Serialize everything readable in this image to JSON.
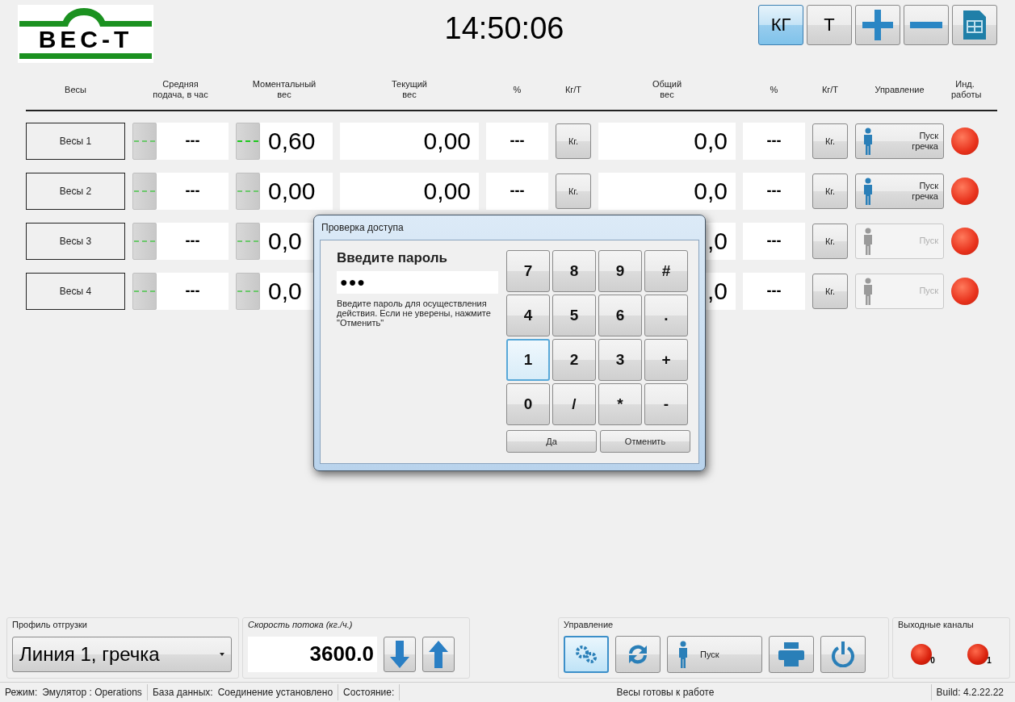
{
  "header": {
    "logo": "ВЕС-Т",
    "clock": "14:50:06",
    "unit_buttons": [
      {
        "label": "КГ",
        "selected": true
      },
      {
        "label": "Т",
        "selected": false
      }
    ],
    "tool_buttons": [
      {
        "kind": "plus"
      },
      {
        "kind": "minus"
      },
      {
        "kind": "table"
      }
    ]
  },
  "columns": [
    "Весы",
    "Средняя\nподача, в час",
    "Моментальный\nвес",
    "Текущий\nвес",
    "%",
    "Кг/Т",
    "Общий\nвес",
    "%",
    "Кг/Т",
    "Управление",
    "Инд.\nработы"
  ],
  "scales": [
    {
      "name": "Весы 1",
      "avg": "---",
      "avg_active": false,
      "moment": "0,60",
      "moment_active": true,
      "current": "0,00",
      "pct": "---",
      "unit": "Кг.",
      "total": "0,0",
      "pct2": "---",
      "unit2": "Кг.",
      "control": {
        "label": "Пуск\nгречка",
        "enabled": true
      }
    },
    {
      "name": "Весы 2",
      "avg": "---",
      "avg_active": false,
      "moment": "0,00",
      "moment_active": false,
      "current": "0,00",
      "pct": "---",
      "unit": "Кг.",
      "total": "0,0",
      "pct2": "---",
      "unit2": "Кг.",
      "control": {
        "label": "Пуск\nгречка",
        "enabled": true
      }
    },
    {
      "name": "Весы 3",
      "avg": "---",
      "avg_active": false,
      "moment": "0,0",
      "moment_active": false,
      "total": ",0",
      "pct2": "---",
      "unit2": "Кг.",
      "control": {
        "label": "Пуск",
        "enabled": false
      }
    },
    {
      "name": "Весы 4",
      "avg": "---",
      "avg_active": false,
      "moment": "0,0",
      "moment_active": false,
      "total": ",0",
      "pct2": "---",
      "unit2": "Кг.",
      "control": {
        "label": "Пуск",
        "enabled": false
      }
    }
  ],
  "dialog": {
    "title": "Проверка доступа",
    "heading": "Введите пароль",
    "password": "●●●",
    "hint": "Введите пароль для осуществления действия. Если не уверены, нажмите \"Отменить\"",
    "keys": [
      {
        "label": "7",
        "focused": false
      },
      {
        "label": "8",
        "focused": false
      },
      {
        "label": "9",
        "focused": false
      },
      {
        "label": "#",
        "focused": false
      },
      {
        "label": "4",
        "focused": false
      },
      {
        "label": "5",
        "focused": false
      },
      {
        "label": "6",
        "focused": false
      },
      {
        "label": ".",
        "focused": false
      },
      {
        "label": "1",
        "focused": true
      },
      {
        "label": "2",
        "focused": false
      },
      {
        "label": "3",
        "focused": false
      },
      {
        "label": "+",
        "focused": false
      },
      {
        "label": "0",
        "focused": false
      },
      {
        "label": "/",
        "focused": false
      },
      {
        "label": "*",
        "focused": false
      },
      {
        "label": "-",
        "focused": false
      }
    ],
    "buttons": [
      "Да",
      "Отменить"
    ]
  },
  "bottom": {
    "profile": {
      "label": "Профиль отгрузки",
      "value": "Линия 1, гречка"
    },
    "speed": {
      "label": "Скорость потока (кг./ч.)",
      "value": "3600.0"
    },
    "control": {
      "label": "Управление",
      "start": "Пуск",
      "settings_selected": true
    },
    "outputs": {
      "label": "Выходные каналы",
      "channels": [
        "0",
        "1"
      ]
    }
  },
  "status_bar": {
    "mode_label": "Режим:",
    "mode": "Эмулятор : Operations",
    "db_label": "База данных:",
    "db": "Соединение установлено",
    "state_label": "Состояние:",
    "state": "Весы готовы к работе",
    "build": "Build: 4.2.22.22"
  }
}
